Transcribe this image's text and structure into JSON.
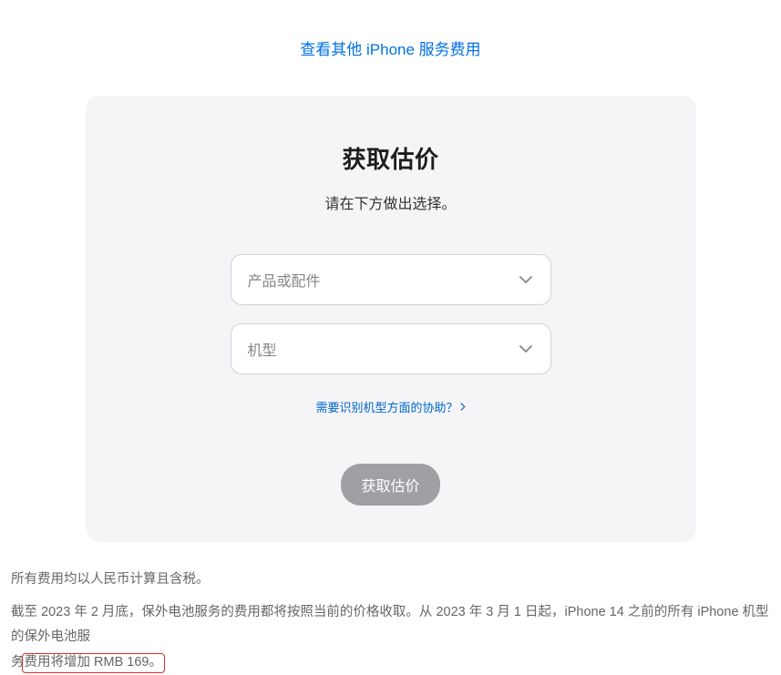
{
  "top_link": "查看其他 iPhone 服务费用",
  "card": {
    "title": "获取估价",
    "subtitle": "请在下方做出选择。",
    "select1_placeholder": "产品或配件",
    "select2_placeholder": "机型",
    "help_link": "需要识别机型方面的协助？",
    "button_label": "获取估价"
  },
  "footer": {
    "line1": "所有费用均以人民币计算且含税。",
    "line2_part1": "截至 2023 年 2 月底，保外电池服务的费用都将按照当前的价格收取。从 2023 年 3 月 1 日起，iPhone 14 之前的所有 iPhone 机型的保外电池服",
    "line2_part2": "务",
    "line2_highlight": "费用将增加 RMB 169。"
  }
}
